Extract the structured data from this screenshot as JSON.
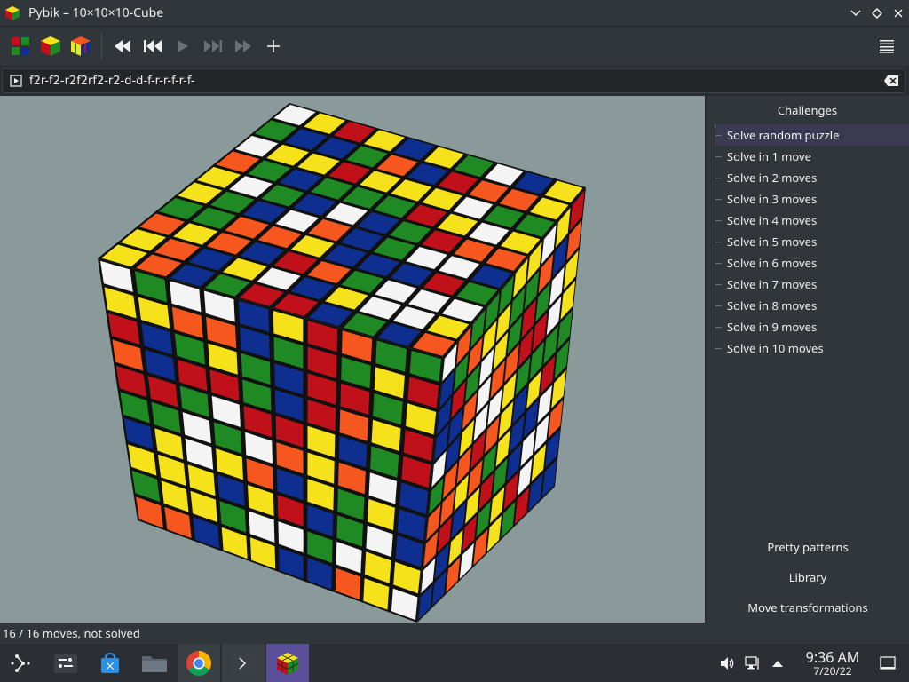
{
  "window": {
    "title": "Pybik – 10×10×10-Cube"
  },
  "movefield": {
    "moves": "f2r-f2-r2f2rf2-r2-d-d-f-r-r-f-r-f-"
  },
  "sidepanel": {
    "challenges_title": "Challenges",
    "challenges": [
      "Solve random puzzle",
      "Solve in 1 move",
      "Solve in 2 moves",
      "Solve in 3 moves",
      "Solve in 4 moves",
      "Solve in 5 moves",
      "Solve in 6 moves",
      "Solve in 7 moves",
      "Solve in 8 moves",
      "Solve in 9 moves",
      "Solve in 10 moves"
    ],
    "selected_index": 0,
    "buttons": [
      "Pretty patterns",
      "Library",
      "Move transformations"
    ]
  },
  "status": {
    "text": "16 / 16 moves, not solved"
  },
  "clock": {
    "time": "9:36 AM",
    "date": "7/20/22"
  },
  "colors": {
    "red": "#c0111a",
    "green": "#1f8a24",
    "blue": "#0e2f8f",
    "white": "#f4f4f4",
    "yellow": "#f6e21b",
    "orange": "#f5571f",
    "selection": "#3b3a52",
    "taskbar_current": "#5b4f99"
  }
}
